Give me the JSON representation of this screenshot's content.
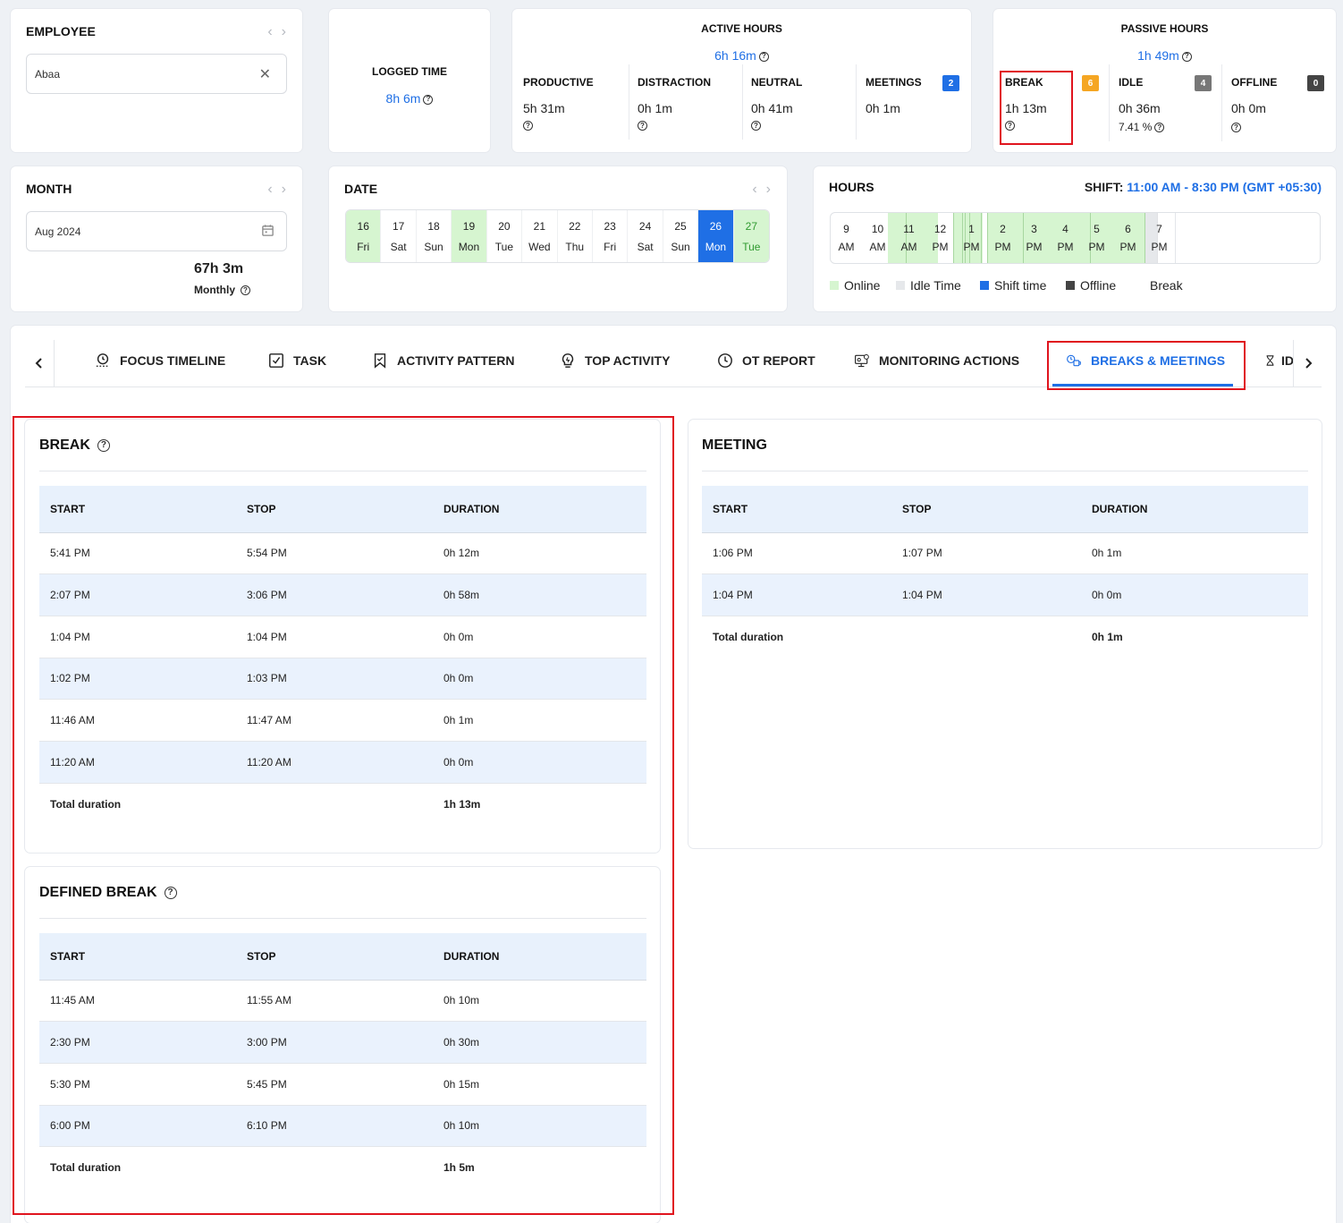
{
  "employee": {
    "title": "EMPLOYEE",
    "value": "Abaa"
  },
  "logged_time": {
    "title": "LOGGED TIME",
    "value": "8h 6m"
  },
  "active_hours": {
    "title": "ACTIVE HOURS",
    "total": "6h 16m",
    "items": [
      {
        "label": "PRODUCTIVE",
        "value": "5h 31m"
      },
      {
        "label": "DISTRACTION",
        "value": "0h 1m"
      },
      {
        "label": "NEUTRAL",
        "value": "0h 41m"
      },
      {
        "label": "MEETINGS",
        "value": "0h 1m",
        "badge": "2"
      }
    ]
  },
  "passive_hours": {
    "title": "PASSIVE HOURS",
    "total": "1h 49m",
    "items": [
      {
        "label": "BREAK",
        "value": "1h 13m",
        "badge": "6"
      },
      {
        "label": "IDLE",
        "value": "0h 36m",
        "sub": "7.41 %",
        "badge": "4"
      },
      {
        "label": "OFFLINE",
        "value": "0h 0m",
        "badge": "0"
      }
    ]
  },
  "month": {
    "title": "MONTH",
    "value": "Aug 2024",
    "total": "67h 3m",
    "total_label": "Monthly"
  },
  "date": {
    "title": "DATE",
    "days": [
      {
        "num": "16",
        "day": "Fri"
      },
      {
        "num": "17",
        "day": "Sat"
      },
      {
        "num": "18",
        "day": "Sun"
      },
      {
        "num": "19",
        "day": "Mon"
      },
      {
        "num": "20",
        "day": "Tue"
      },
      {
        "num": "21",
        "day": "Wed"
      },
      {
        "num": "22",
        "day": "Thu"
      },
      {
        "num": "23",
        "day": "Fri"
      },
      {
        "num": "24",
        "day": "Sat"
      },
      {
        "num": "25",
        "day": "Sun"
      },
      {
        "num": "26",
        "day": "Mon"
      },
      {
        "num": "27",
        "day": "Tue"
      }
    ]
  },
  "hours": {
    "title": "HOURS",
    "shift_label": "SHIFT:",
    "shift_value": "11:00 AM - 8:30 PM (GMT +05:30)",
    "ticks": [
      {
        "h": "9",
        "p": "AM"
      },
      {
        "h": "10",
        "p": "AM"
      },
      {
        "h": "11",
        "p": "AM"
      },
      {
        "h": "12",
        "p": "PM"
      },
      {
        "h": "1",
        "p": "PM"
      },
      {
        "h": "2",
        "p": "PM"
      },
      {
        "h": "3",
        "p": "PM"
      },
      {
        "h": "4",
        "p": "PM"
      },
      {
        "h": "5",
        "p": "PM"
      },
      {
        "h": "6",
        "p": "PM"
      },
      {
        "h": "7",
        "p": "PM"
      }
    ],
    "legend": [
      "Online",
      "Idle Time",
      "Shift time",
      "Offline",
      "Break"
    ]
  },
  "tabs": [
    "FOCUS TIMELINE",
    "TASK",
    "ACTIVITY PATTERN",
    "TOP ACTIVITY",
    "OT REPORT",
    "MONITORING ACTIONS",
    "BREAKS & MEETINGS",
    "ID"
  ],
  "break_table": {
    "title": "BREAK",
    "headers": [
      "START",
      "STOP",
      "DURATION"
    ],
    "rows": [
      [
        "5:41 PM",
        "5:54 PM",
        "0h 12m"
      ],
      [
        "2:07 PM",
        "3:06 PM",
        "0h 58m"
      ],
      [
        "1:04 PM",
        "1:04 PM",
        "0h 0m"
      ],
      [
        "1:02 PM",
        "1:03 PM",
        "0h 0m"
      ],
      [
        "11:46 AM",
        "11:47 AM",
        "0h 1m"
      ],
      [
        "11:20 AM",
        "11:20 AM",
        "0h 0m"
      ]
    ],
    "total_label": "Total duration",
    "total": "1h 13m"
  },
  "defined_break_table": {
    "title": "DEFINED BREAK",
    "headers": [
      "START",
      "STOP",
      "DURATION"
    ],
    "rows": [
      [
        "11:45 AM",
        "11:55 AM",
        "0h 10m"
      ],
      [
        "2:30 PM",
        "3:00 PM",
        "0h 30m"
      ],
      [
        "5:30 PM",
        "5:45 PM",
        "0h 15m"
      ],
      [
        "6:00 PM",
        "6:10 PM",
        "0h 10m"
      ]
    ],
    "total_label": "Total duration",
    "total": "1h 5m"
  },
  "meeting_table": {
    "title": "MEETING",
    "headers": [
      "START",
      "STOP",
      "DURATION"
    ],
    "rows": [
      [
        "1:06 PM",
        "1:07 PM",
        "0h 1m"
      ],
      [
        "1:04 PM",
        "1:04 PM",
        "0h 0m"
      ]
    ],
    "total_label": "Total duration",
    "total": "0h 1m"
  },
  "colors": {
    "accent": "#1f6fe5",
    "online": "#d6f5d0",
    "break_badge": "#f5a623",
    "grey_badge": "#777777",
    "dark_badge": "#444444",
    "highlight": "#e0141e"
  }
}
